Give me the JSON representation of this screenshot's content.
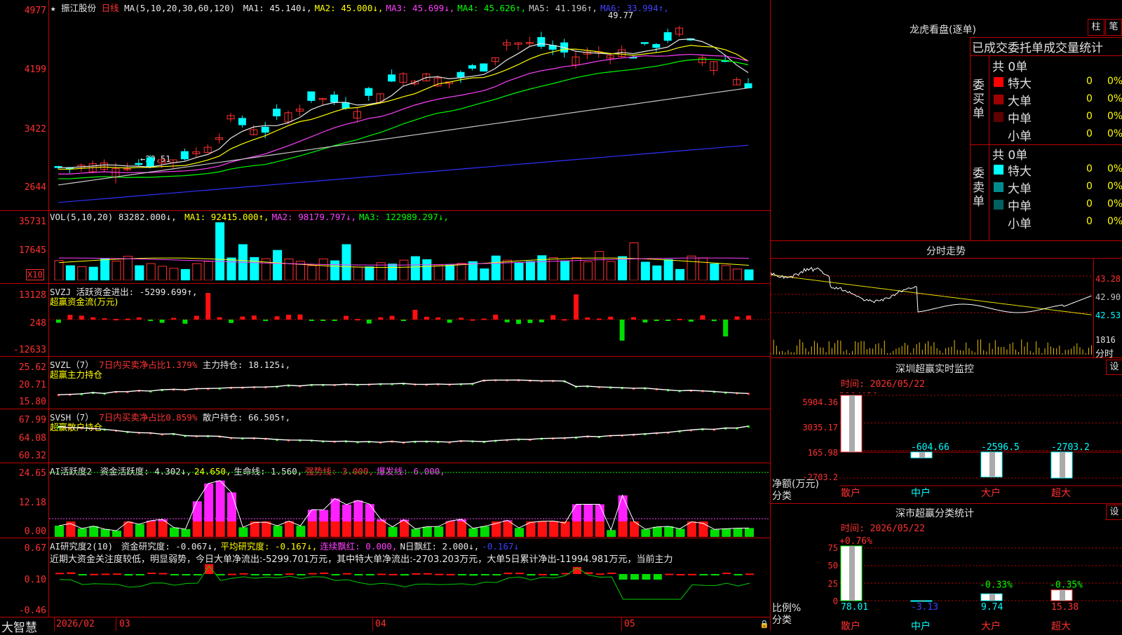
{
  "stock": {
    "name": "振江股份",
    "period": "日线",
    "ma_label": "MA(5,10,20,30,60,120)",
    "ma": [
      {
        "label": "MA1:",
        "value": "45.140",
        "arrow": "↓",
        "color": "#e8e8e8"
      },
      {
        "label": "MA2:",
        "value": "45.000",
        "arrow": "↓",
        "color": "#ffff00"
      },
      {
        "label": "MA3:",
        "value": "45.699",
        "arrow": "↓",
        "color": "#ff40ff"
      },
      {
        "label": "MA4:",
        "value": "45.626",
        "arrow": "↑",
        "color": "#00ff00"
      },
      {
        "label": "MA5:",
        "value": "41.196",
        "arrow": "↑",
        "color": "#c8c8c8"
      },
      {
        "label": "MA6:",
        "value": "33.994",
        "arrow": "↑",
        "color": "#4040ff"
      }
    ],
    "high_mark": "49.77",
    "low_mark": "30.51",
    "price_ticks": [
      "4977",
      "4199",
      "3422",
      "2644"
    ]
  },
  "vol": {
    "title": "VOL(5,10,20)",
    "value": "83282.000",
    "ma": [
      {
        "label": "MA1:",
        "value": "92415.000",
        "arrow": "↑",
        "color": "#ffff00"
      },
      {
        "label": "MA2:",
        "value": "98179.797",
        "arrow": "↓",
        "color": "#ff40ff"
      },
      {
        "label": "MA3:",
        "value": "122989.297",
        "arrow": "↓",
        "color": "#00ff00"
      }
    ],
    "ticks": [
      "35731",
      "17645"
    ],
    "unit": "X10"
  },
  "svzj": {
    "title": "SVZJ",
    "label": "活跃资金进出:",
    "value": "-5299.699",
    "sub": "超赢资金流(万元)",
    "ticks": [
      "13128",
      "248",
      "-12633"
    ]
  },
  "svzl": {
    "title": "SVZL（7）",
    "text1": "7日内买卖净占比1.379%",
    "label": "主力持仓:",
    "value": "18.125",
    "sub": "超赢主力持仓",
    "ticks": [
      "25.62",
      "20.71",
      "15.80"
    ]
  },
  "svsh": {
    "title": "SVSH（7）",
    "text1": "7日内买卖净占比0.859%",
    "label": "散户持仓:",
    "value": "66.505",
    "sub": "超赢散户持仓",
    "ticks": [
      "67.99",
      "64.08",
      "60.32"
    ]
  },
  "ai1": {
    "title": "AI活跃度2",
    "items": [
      {
        "text": "资金活跃度: 4.302↓,",
        "color": "#e8e8e8"
      },
      {
        "text": "24.650,",
        "color": "#ffff00"
      },
      {
        "text": "生命线: 1.560,",
        "color": "#e8e8e8"
      },
      {
        "text": "强势线: 3.000,",
        "color": "#ff3333"
      },
      {
        "text": "爆发线: 6.000,",
        "color": "#ff40ff"
      }
    ],
    "ticks": [
      "24.65",
      "12.18",
      "0.00"
    ]
  },
  "ai2": {
    "title": "AI研究度2(10)",
    "items": [
      {
        "text": "资金研究度: -0.067↓,",
        "color": "#e8e8e8"
      },
      {
        "text": "平均研究度: -0.167↓,",
        "color": "#ffff00"
      },
      {
        "text": "连续飘红: 0.000,",
        "color": "#ff40ff"
      },
      {
        "text": "N日飘红: 2.000↓,",
        "color": "#e8e8e8"
      },
      {
        "text": "-0.167↓",
        "color": "#4040ff"
      }
    ],
    "summary": "近期大资金关注度较低，明显弱势，今日大单净流出:-5299.701万元，其中特大单净流出:-2703.203万元，大单5日累计净出-11994.981万元，当前主力",
    "ticks": [
      "0.67",
      "0.10",
      "-0.46"
    ]
  },
  "dates": {
    "brand": "大智慧",
    "labels": [
      "2026/02",
      "03",
      "04",
      "05"
    ]
  },
  "lhb": {
    "title": "龙虎看盘(逐单)",
    "btn1": "柱",
    "btn2": "笔",
    "tabs": "已成交委托单成交量统计",
    "buy_side": "委买单",
    "sell_side": "委卖单",
    "buy_total": "共 0单",
    "sell_total": "共 0单",
    "buy_rows": [
      {
        "label": "特大",
        "count": "0",
        "pct": "0%",
        "color": "#ff0000"
      },
      {
        "label": "大单",
        "count": "0",
        "pct": "0%",
        "color": "#a00000"
      },
      {
        "label": "中单",
        "count": "0",
        "pct": "0%",
        "color": "#600000"
      },
      {
        "label": "小单",
        "count": "0",
        "pct": "0%",
        "color": "#000000"
      }
    ],
    "sell_rows": [
      {
        "label": "特大",
        "count": "0",
        "pct": "0%",
        "color": "#00ffff"
      },
      {
        "label": "大单",
        "count": "0",
        "pct": "0%",
        "color": "#008c8c"
      },
      {
        "label": "中单",
        "count": "0",
        "pct": "0%",
        "color": "#006060"
      },
      {
        "label": "小单",
        "count": "0",
        "pct": "0%",
        "color": "#000000"
      }
    ]
  },
  "intraday": {
    "title": "分时走势",
    "ticks": [
      "43.28",
      "42.90",
      "42.53"
    ],
    "vol_tick": "1816",
    "vol_unit": "分时"
  },
  "monitor": {
    "title": "深圳超赢实时监控",
    "btn": "设",
    "time": "时间: 2026/05/22",
    "ticks": [
      "5904.36",
      "3035.17",
      "165.98",
      "-2703.2"
    ],
    "ylabel": "净额(万元)",
    "xlabel": "分类",
    "bars": [
      {
        "cat": "散户",
        "value": "5904.36",
        "color": "#ff3030"
      },
      {
        "cat": "中户",
        "value": "-604.66",
        "color": "#00ffff"
      },
      {
        "cat": "大户",
        "value": "-2596.5",
        "color": "#00ffff"
      },
      {
        "cat": "超大",
        "value": "-2703.2",
        "color": "#00ffff"
      }
    ],
    "cat_colors": [
      "#ff3030",
      "#00ffff",
      "#ff3030",
      "#ff3030"
    ]
  },
  "classify": {
    "title": "深市超赢分类统计",
    "btn": "设",
    "time": "时间: 2026/05/22",
    "ticks": [
      "75",
      "50",
      "25",
      "0"
    ],
    "ylabel": "比例%",
    "xlabel": "分类",
    "top_labels": [
      {
        "text": "+0.76%",
        "color": "#ff3030"
      },
      {
        "text": "-0.33%",
        "color": "#00ff00"
      },
      {
        "text": "-0.35%",
        "color": "#00ff00"
      }
    ],
    "bars": [
      {
        "cat": "散户",
        "value": "78.01",
        "color": "#00ffff"
      },
      {
        "cat": "中户",
        "value": "-3.13",
        "color": "#4040ff"
      },
      {
        "cat": "大户",
        "value": "9.74",
        "color": "#00ffff"
      },
      {
        "cat": "超大",
        "value": "15.38",
        "color": "#ff3030"
      }
    ]
  }
}
